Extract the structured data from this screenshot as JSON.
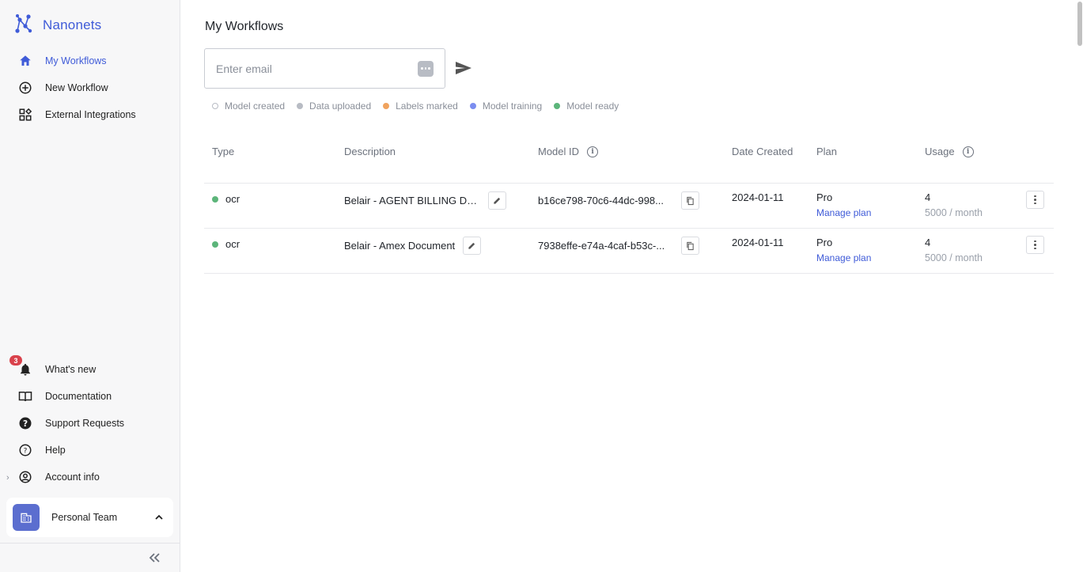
{
  "brand": {
    "name": "Nanonets",
    "icon": "nanonets-logo"
  },
  "sidebar": {
    "nav": [
      {
        "label": "My Workflows",
        "icon": "home-icon",
        "active": true
      },
      {
        "label": "New Workflow",
        "icon": "plus-circle-icon"
      },
      {
        "label": "External Integrations",
        "icon": "grid-icon"
      }
    ],
    "bottom": [
      {
        "label": "What's new",
        "icon": "bell-icon",
        "badge": "3"
      },
      {
        "label": "Documentation",
        "icon": "book-icon"
      },
      {
        "label": "Support Requests",
        "icon": "help-filled-icon"
      },
      {
        "label": "Help",
        "icon": "help-circle-icon"
      },
      {
        "label": "Account info",
        "icon": "account-icon"
      }
    ],
    "team": {
      "name": "Personal Team",
      "icon": "building-icon"
    }
  },
  "main": {
    "title": "My Workflows",
    "email_placeholder": "Enter email",
    "legend": [
      {
        "label": "Model created",
        "color": "#ffffff"
      },
      {
        "label": "Data uploaded",
        "color": "#b8bcc4"
      },
      {
        "label": "Labels marked",
        "color": "#f0a35e"
      },
      {
        "label": "Model training",
        "color": "#7b8df0"
      },
      {
        "label": "Model ready",
        "color": "#5cb57a"
      }
    ],
    "columns": [
      "Type",
      "Description",
      "Model ID",
      "Date Created",
      "Plan",
      "Usage"
    ],
    "rows": [
      {
        "type": "ocr",
        "status_color": "#5cb57a",
        "description": "Belair - AGENT BILLING DE...",
        "model_id": "b16ce798-70c6-44dc-998...",
        "date": "2024-01-11",
        "plan": "Pro",
        "manage": "Manage plan",
        "usage": "4",
        "limit": "5000 / month"
      },
      {
        "type": "ocr",
        "status_color": "#5cb57a",
        "description": "Belair - Amex Document",
        "model_id": "7938effe-e74a-4caf-b53c-...",
        "date": "2024-01-11",
        "plan": "Pro",
        "manage": "Manage plan",
        "usage": "4",
        "limit": "5000 / month"
      }
    ]
  },
  "colors": {
    "accent": "#3f5bd8",
    "ready": "#5cb57a",
    "badge": "#d9414b"
  }
}
